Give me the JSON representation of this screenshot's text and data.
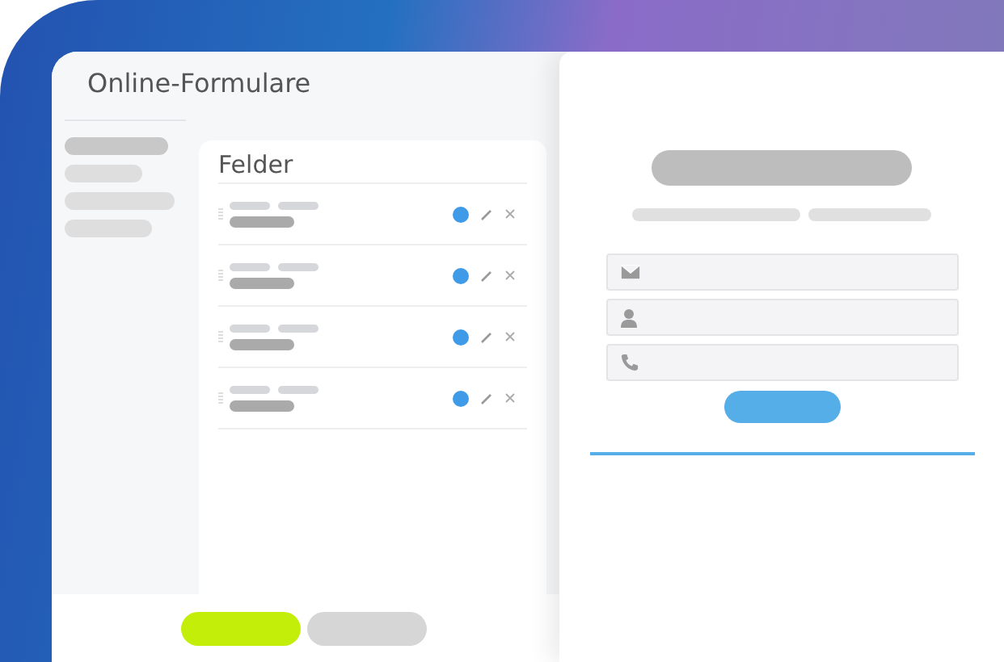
{
  "app": {
    "title": "Online-Formulare"
  },
  "sidebar": {
    "items": [
      {
        "selected": true
      },
      {
        "selected": false
      },
      {
        "selected": false
      },
      {
        "selected": false
      }
    ]
  },
  "fields_panel": {
    "heading": "Felder",
    "rows": [
      {
        "kind": "field"
      },
      {
        "kind": "field"
      },
      {
        "kind": "field"
      },
      {
        "kind": "field"
      }
    ]
  },
  "bottom_bar": {
    "buttons": [
      {
        "kind": "primary"
      },
      {
        "kind": "secondary"
      }
    ]
  },
  "preview": {
    "inputs": [
      {
        "kind": "email"
      },
      {
        "kind": "name"
      },
      {
        "kind": "phone"
      }
    ]
  }
}
